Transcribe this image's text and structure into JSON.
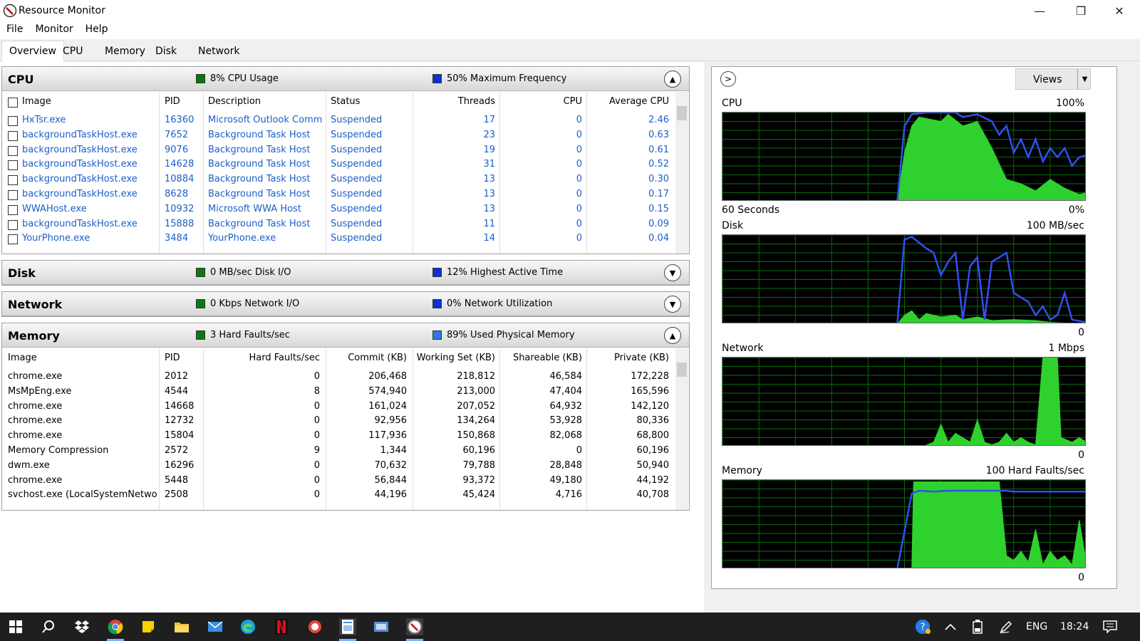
{
  "window": {
    "title": "Resource Monitor",
    "minimize": "—",
    "restore": "❐",
    "close": "✕"
  },
  "menu": [
    "File",
    "Monitor",
    "Help"
  ],
  "tabs": [
    "Overview",
    "CPU",
    "Memory",
    "Disk",
    "Network"
  ],
  "cpu": {
    "name": "CPU",
    "stat1": "8% CPU Usage",
    "stat1_color": "#0a7a0a",
    "stat2": "50% Maximum Frequency",
    "stat2_color": "#1030d0",
    "columns": [
      "Image",
      "PID",
      "Description",
      "Status",
      "Threads",
      "CPU",
      "Average CPU"
    ],
    "rows": [
      [
        "HxTsr.exe",
        "16360",
        "Microsoft Outlook Comm...",
        "Suspended",
        "17",
        "0",
        "2.46"
      ],
      [
        "backgroundTaskHost.exe",
        "7652",
        "Background Task Host",
        "Suspended",
        "23",
        "0",
        "0.63"
      ],
      [
        "backgroundTaskHost.exe",
        "9076",
        "Background Task Host",
        "Suspended",
        "19",
        "0",
        "0.61"
      ],
      [
        "backgroundTaskHost.exe",
        "14628",
        "Background Task Host",
        "Suspended",
        "31",
        "0",
        "0.52"
      ],
      [
        "backgroundTaskHost.exe",
        "10884",
        "Background Task Host",
        "Suspended",
        "13",
        "0",
        "0.30"
      ],
      [
        "backgroundTaskHost.exe",
        "8628",
        "Background Task Host",
        "Suspended",
        "13",
        "0",
        "0.17"
      ],
      [
        "WWAHost.exe",
        "10932",
        "Microsoft WWA Host",
        "Suspended",
        "13",
        "0",
        "0.15"
      ],
      [
        "backgroundTaskHost.exe",
        "15888",
        "Background Task Host",
        "Suspended",
        "11",
        "0",
        "0.09"
      ],
      [
        "YourPhone.exe",
        "3484",
        "YourPhone.exe",
        "Suspended",
        "14",
        "0",
        "0.04"
      ]
    ]
  },
  "disk": {
    "name": "Disk",
    "stat1": "0 MB/sec Disk I/O",
    "stat2": "12% Highest Active Time"
  },
  "network": {
    "name": "Network",
    "stat1": "0 Kbps Network I/O",
    "stat2": "0% Network Utilization"
  },
  "memory": {
    "name": "Memory",
    "stat1": "3 Hard Faults/sec",
    "stat2": "89% Used Physical Memory",
    "stat2_color": "#2a7ae0",
    "columns": [
      "Image",
      "PID",
      "Hard Faults/sec",
      "Commit (KB)",
      "Working Set (KB)",
      "Shareable (KB)",
      "Private (KB)"
    ],
    "rows": [
      [
        "chrome.exe",
        "2012",
        "0",
        "206,468",
        "218,812",
        "46,584",
        "172,228"
      ],
      [
        "MsMpEng.exe",
        "4544",
        "8",
        "574,940",
        "213,000",
        "47,404",
        "165,596"
      ],
      [
        "chrome.exe",
        "14668",
        "0",
        "161,024",
        "207,052",
        "64,932",
        "142,120"
      ],
      [
        "chrome.exe",
        "12732",
        "0",
        "92,956",
        "134,264",
        "53,928",
        "80,336"
      ],
      [
        "chrome.exe",
        "15804",
        "0",
        "117,936",
        "150,868",
        "82,068",
        "68,800"
      ],
      [
        "Memory Compression",
        "2572",
        "9",
        "1,344",
        "60,196",
        "0",
        "60,196"
      ],
      [
        "dwm.exe",
        "16296",
        "0",
        "70,632",
        "79,788",
        "28,848",
        "50,940"
      ],
      [
        "chrome.exe",
        "5448",
        "0",
        "56,844",
        "93,372",
        "49,180",
        "44,192"
      ],
      [
        "svchost.exe (LocalSystemNetworkR...",
        "2508",
        "0",
        "44,196",
        "45,424",
        "4,716",
        "40,708"
      ]
    ]
  },
  "graphs": {
    "views_label": "Views",
    "cpu": {
      "title": "CPU",
      "max": "100%",
      "time": "60 Seconds",
      "min": "0%"
    },
    "disk": {
      "title": "Disk",
      "max": "100 MB/sec",
      "min": "0"
    },
    "network": {
      "title": "Network",
      "max": "1 Mbps",
      "min": "0"
    },
    "memory": {
      "title": "Memory",
      "max": "100 Hard Faults/sec",
      "min": "0"
    }
  },
  "taskbar": {
    "language": "ENG",
    "time": "18:24"
  }
}
